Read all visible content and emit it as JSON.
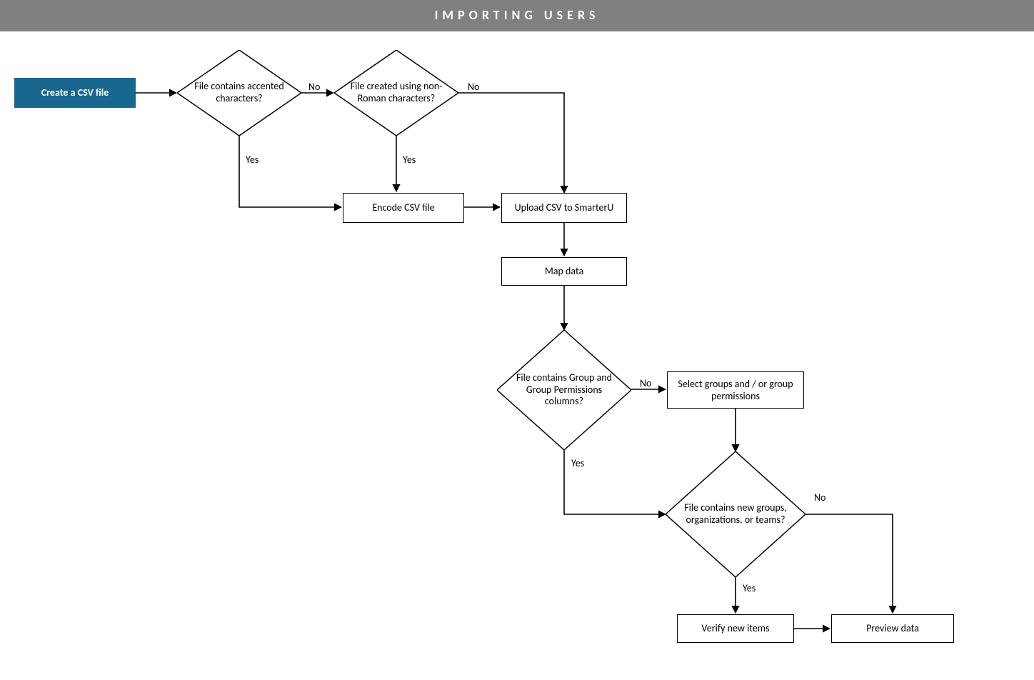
{
  "header": {
    "title": "IMPORTING USERS"
  },
  "nodes": {
    "start": {
      "label": "Create a CSV file"
    },
    "d_accented": {
      "label": "File contains accented characters?"
    },
    "d_nonroman": {
      "label": "File created using non-Roman characters?"
    },
    "encode": {
      "label": "Encode CSV file"
    },
    "upload": {
      "label": "Upload CSV to SmarterU"
    },
    "map": {
      "label": "Map data"
    },
    "d_groupcols": {
      "label": "File contains Group and Group Permissions columns?"
    },
    "selectgroups": {
      "label": "Select groups and / or group permissions"
    },
    "d_newgroups": {
      "label": "File contains new groups, organizations, or teams?"
    },
    "verify": {
      "label": "Verify new items"
    },
    "preview": {
      "label": "Preview data"
    }
  },
  "edges": {
    "yes": "Yes",
    "no": "No"
  },
  "colors": {
    "header_bg": "#808080",
    "start_bg": "#17678f"
  }
}
